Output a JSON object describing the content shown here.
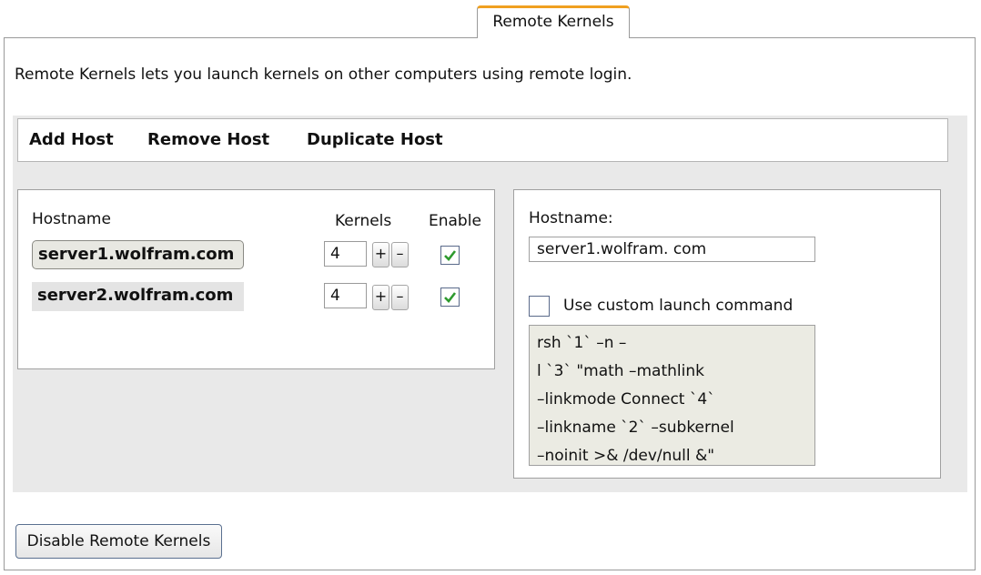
{
  "tab": {
    "label": "Remote Kernels"
  },
  "intro": "Remote Kernels lets you launch kernels on other computers using remote login.",
  "toolbar": {
    "add_host": "Add Host",
    "remove_host": "Remove Host",
    "duplicate_host": "Duplicate Host"
  },
  "host_list": {
    "col_hostname": "Hostname",
    "col_kernels": "Kernels",
    "col_enable": "Enable",
    "rows": [
      {
        "hostname": "server1.wolfram.com",
        "kernels": "4",
        "enabled": true,
        "selected": true
      },
      {
        "hostname": "server2.wolfram.com",
        "kernels": "4",
        "enabled": true,
        "selected": false
      }
    ],
    "plus_label": "+",
    "minus_label": "–"
  },
  "details": {
    "hostname_label": "Hostname:",
    "hostname_value": "server1.wolfram. com",
    "custom_launch_label": "Use custom launch command",
    "custom_launch_checked": false,
    "command_lines": [
      "rsh `1` –n –",
      "l `3` \"math –mathlink",
      "–linkmode Connect `4`",
      "–linkname `2` –subkernel",
      "–noinit >& /dev/null &\""
    ]
  },
  "footer": {
    "disable_button": "Disable Remote Kernels"
  },
  "colors": {
    "tab_accent": "#f0a020",
    "check_green": "#2e9a2e",
    "panel_bg": "#e9e9e9"
  }
}
